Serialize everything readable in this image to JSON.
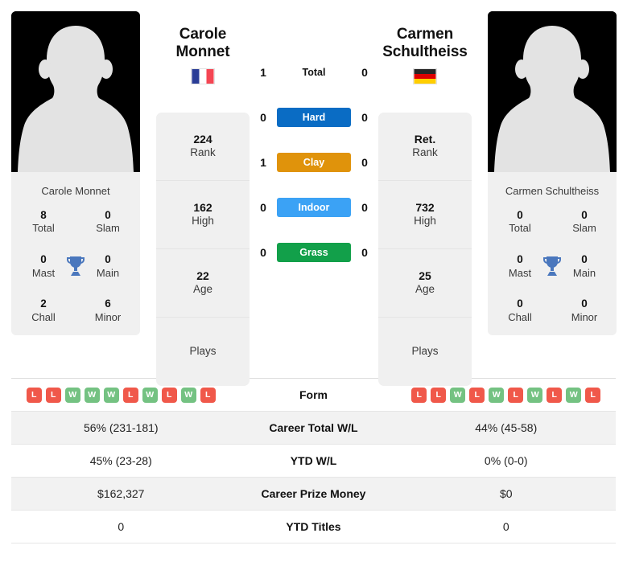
{
  "colors": {
    "win": "#74c282",
    "loss": "#f0584a",
    "hard": "#0a6cc4",
    "clay": "#e0930b",
    "indoor": "#3ba2f5",
    "grass": "#12a04a",
    "trophy": "#4a77bd",
    "card_bg": "#f0f0f0",
    "row_alt_bg": "#f2f2f2"
  },
  "players": {
    "left": {
      "first_name": "Carole",
      "last_name": "Monnet",
      "full_name": "Carole Monnet",
      "country": "France",
      "flag_icon": "flag-france",
      "photo_caption": "Carole Monnet",
      "stats": [
        {
          "value": "224",
          "label": "Rank"
        },
        {
          "value": "162",
          "label": "High"
        },
        {
          "value": "22",
          "label": "Age"
        },
        {
          "value": "",
          "label": "Plays"
        }
      ],
      "titles": [
        {
          "value": "8",
          "label": "Total"
        },
        {
          "value": "0",
          "label": "Slam"
        },
        {
          "value": "0",
          "label": "Mast"
        },
        {
          "value": "0",
          "label": "Main"
        },
        {
          "value": "2",
          "label": "Chall"
        },
        {
          "value": "6",
          "label": "Minor"
        }
      ],
      "form": [
        "L",
        "L",
        "W",
        "W",
        "W",
        "L",
        "W",
        "L",
        "W",
        "L"
      ],
      "career_total_wl": "56% (231-181)",
      "ytd_wl": "45% (23-28)",
      "career_prize_money": "$162,327",
      "ytd_titles": "0"
    },
    "right": {
      "first_name": "Carmen",
      "last_name": "Schultheiss",
      "full_name": "Carmen Schultheiss",
      "country": "Germany",
      "flag_icon": "flag-germany",
      "photo_caption": "Carmen Schultheiss",
      "stats": [
        {
          "value": "Ret.",
          "label": "Rank"
        },
        {
          "value": "732",
          "label": "High"
        },
        {
          "value": "25",
          "label": "Age"
        },
        {
          "value": "",
          "label": "Plays"
        }
      ],
      "titles": [
        {
          "value": "0",
          "label": "Total"
        },
        {
          "value": "0",
          "label": "Slam"
        },
        {
          "value": "0",
          "label": "Mast"
        },
        {
          "value": "0",
          "label": "Main"
        },
        {
          "value": "0",
          "label": "Chall"
        },
        {
          "value": "0",
          "label": "Minor"
        }
      ],
      "form": [
        "L",
        "L",
        "W",
        "L",
        "W",
        "L",
        "W",
        "L",
        "W",
        "L"
      ],
      "career_total_wl": "44% (45-58)",
      "ytd_wl": "0% (0-0)",
      "career_prize_money": "$0",
      "ytd_titles": "0"
    }
  },
  "head_to_head": [
    {
      "label": "Total",
      "left": "1",
      "right": "0",
      "surface": false
    },
    {
      "label": "Hard",
      "left": "0",
      "right": "0",
      "surface": true
    },
    {
      "label": "Clay",
      "left": "1",
      "right": "0",
      "surface": true
    },
    {
      "label": "Indoor",
      "left": "0",
      "right": "0",
      "surface": true
    },
    {
      "label": "Grass",
      "left": "0",
      "right": "0",
      "surface": true
    }
  ],
  "table": {
    "rows": [
      {
        "label": "Form",
        "left": "",
        "right": ""
      },
      {
        "label": "Career Total W/L",
        "left": "56% (231-181)",
        "right": "44% (45-58)"
      },
      {
        "label": "YTD W/L",
        "left": "45% (23-28)",
        "right": "0% (0-0)"
      },
      {
        "label": "Career Prize Money",
        "left": "$162,327",
        "right": "$0"
      },
      {
        "label": "YTD Titles",
        "left": "0",
        "right": "0"
      }
    ]
  }
}
